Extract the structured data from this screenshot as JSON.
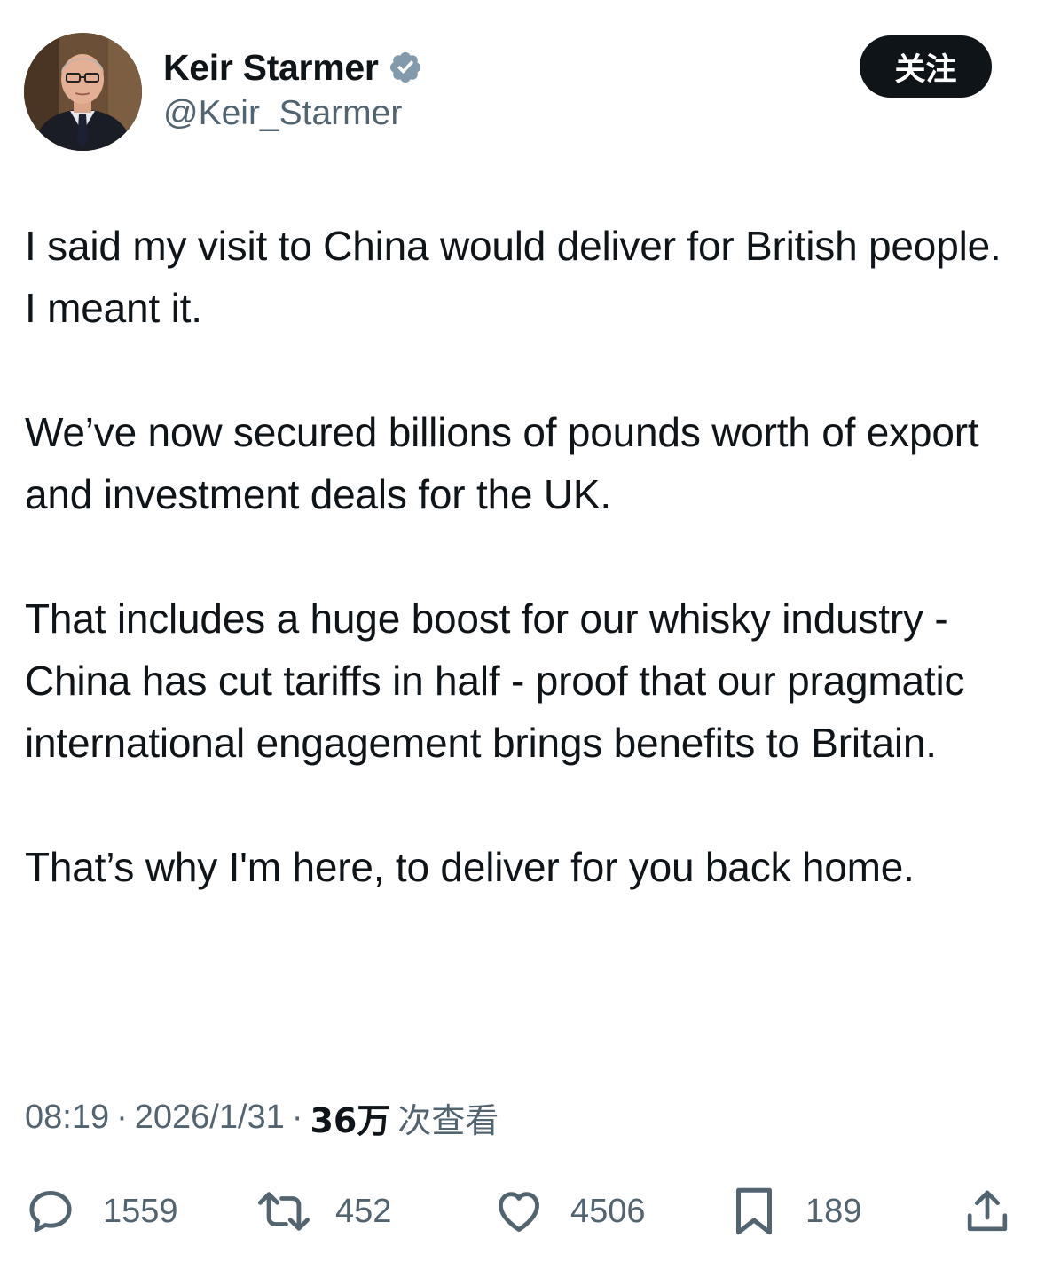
{
  "author": {
    "display_name": "Keir Starmer",
    "handle": "@Keir_Starmer",
    "verified_icon": "verified-badge-icon",
    "avatar": "avatar"
  },
  "follow_button": {
    "label": "关注"
  },
  "tweet": {
    "paragraphs": [
      "I said my visit to China would deliver for British people. I meant it.",
      "We’ve now secured billions of pounds worth of export and investment deals for the UK.",
      "That includes a huge boost for our whisky industry - China has cut tariffs in half - proof that our pragmatic international engagement brings benefits to Britain.",
      "That’s why I'm here, to deliver for you back home."
    ]
  },
  "meta": {
    "time": "08:19",
    "separator": "·",
    "date": "2026/1/31",
    "views_count": "36万",
    "views_label": "次查看"
  },
  "actions": {
    "replies": "1559",
    "reposts": "452",
    "likes": "4506",
    "bookmarks": "189"
  },
  "colors": {
    "text": "#0f1419",
    "secondary": "#536471",
    "verified": "#829aab",
    "button_bg": "#0f1419"
  }
}
